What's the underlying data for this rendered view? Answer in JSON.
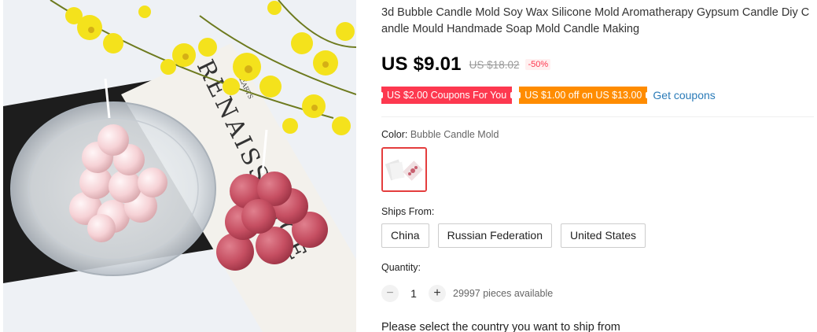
{
  "product": {
    "title": "3d Bubble Candle Mold Soy Wax Silicone Mold Aromatherapy Gypsum Candle Diy Candle Mould Handmade Soap Mold Candle Making",
    "image_alt": "Bubble candle mold product photo",
    "image_text": "RENAISSANCE",
    "image_text_small": "THE",
    "image_text_arts": "ARTS"
  },
  "price": {
    "current": "US $9.01",
    "original": "US $18.02",
    "discount": "-50%"
  },
  "coupons": {
    "coupon1": "US $2.00 Coupons For You",
    "coupon2": "US $1.00 off on US $13.00",
    "get_coupons": "Get coupons",
    "coupon1_color": "#fd384f",
    "coupon2_color": "#ff8c00"
  },
  "color": {
    "label": "Color:",
    "selected": "Bubble Candle Mold",
    "swatch_icon": "candle-mold-thumbnail"
  },
  "shipping": {
    "label": "Ships From:",
    "options": [
      "China",
      "Russian Federation",
      "United States"
    ],
    "note": "Please select the country you want to ship from"
  },
  "quantity": {
    "label": "Quantity:",
    "value": "1",
    "minus": "−",
    "plus": "+",
    "available": "29997 pieces available"
  },
  "colors": {
    "accent_red": "#fd384f",
    "accent_orange": "#ff8c00",
    "link_blue": "#2a7bb8",
    "selected_border": "#e43d3d"
  }
}
